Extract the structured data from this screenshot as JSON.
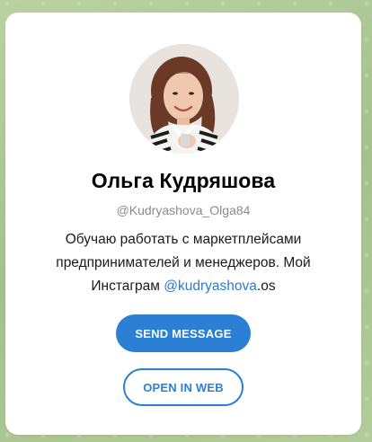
{
  "profile": {
    "name": "Ольга Кудряшова",
    "username": "@Kudryashova_Olga84",
    "description_line1": "Обучаю работать с маркетплейсами",
    "description_line2": "предпринимателей и менеджеров. Мой",
    "description_prefix": "Инстаграм ",
    "instagram_link": "@kudryashova",
    "description_suffix": ".os"
  },
  "actions": {
    "send_message": "SEND MESSAGE",
    "open_in_web": "OPEN IN WEB"
  },
  "colors": {
    "accent": "#2b7fd4",
    "background": "#a9c694"
  }
}
